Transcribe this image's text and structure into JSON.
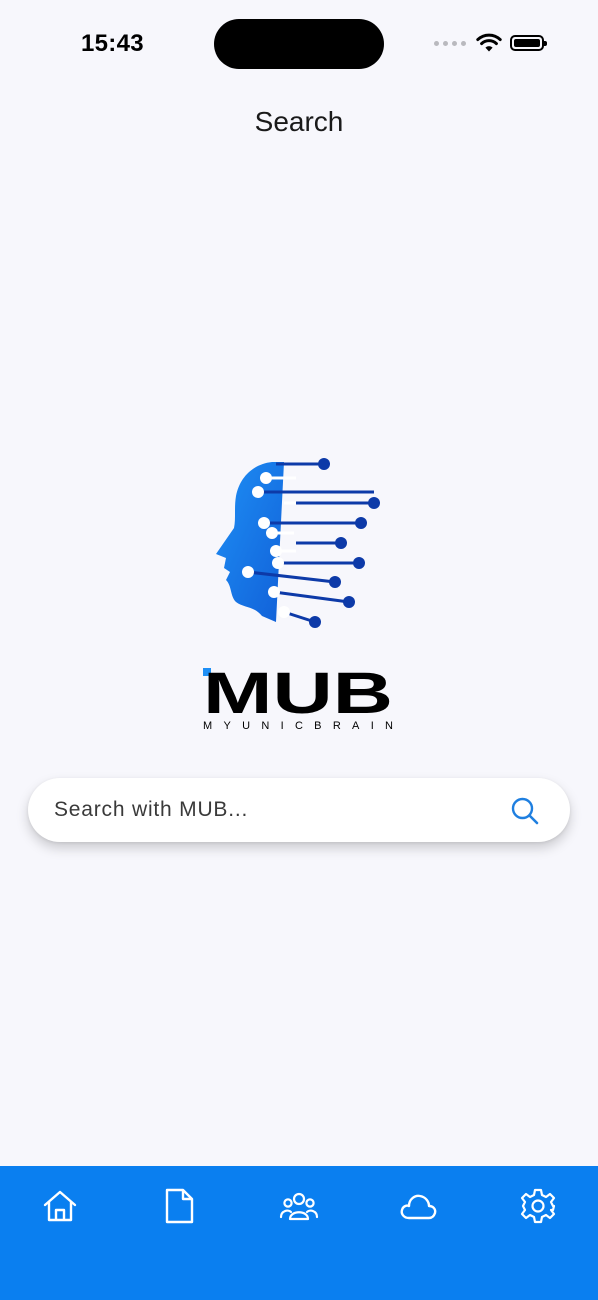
{
  "status_bar": {
    "time": "15:43",
    "icons": [
      "cellular-signal-icon",
      "wifi-icon",
      "battery-icon"
    ]
  },
  "header": {
    "title": "Search"
  },
  "logo": {
    "wordmark": "MUB",
    "tagline": "MYUNICBRAIN",
    "colors": {
      "blue_light": "#1e8ff5",
      "blue_dark": "#0d3aa8",
      "black": "#000000"
    }
  },
  "search": {
    "placeholder": "Search with MUB...",
    "value": "",
    "icon": "search-icon"
  },
  "tab_bar": {
    "background": "#0a7ff0",
    "tabs": [
      {
        "name": "home",
        "icon": "home-icon"
      },
      {
        "name": "documents",
        "icon": "document-icon"
      },
      {
        "name": "community",
        "icon": "users-icon"
      },
      {
        "name": "cloud",
        "icon": "cloud-icon"
      },
      {
        "name": "settings",
        "icon": "gear-icon"
      }
    ]
  }
}
